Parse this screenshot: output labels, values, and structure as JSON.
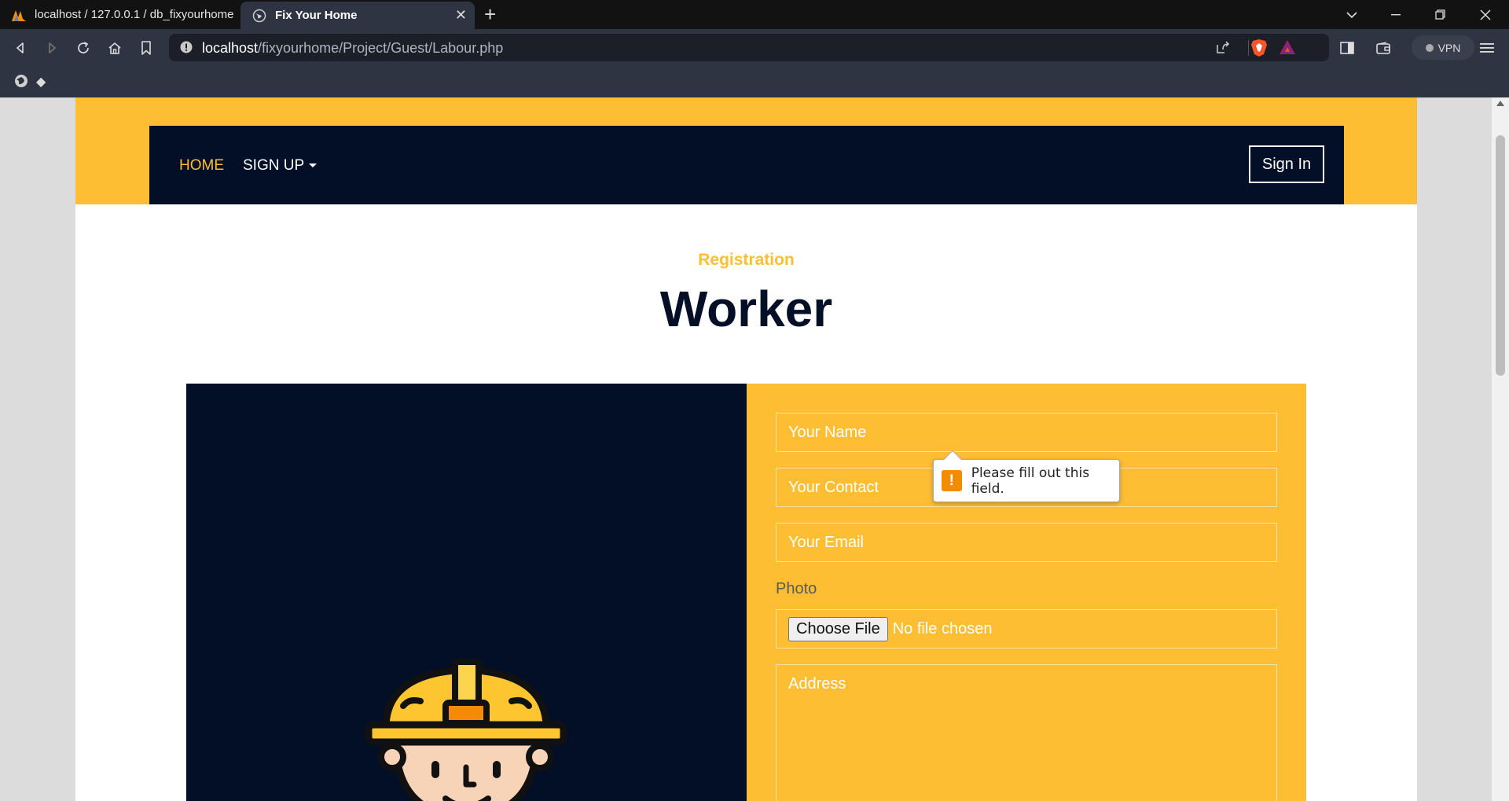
{
  "browser": {
    "tabs": [
      {
        "title": "localhost / 127.0.0.1 / db_fixyourhome",
        "active": false
      },
      {
        "title": "Fix Your Home",
        "active": true
      }
    ],
    "url_host": "localhost",
    "url_path": "/fixyourhome/Project/Guest/Labour.php",
    "vpn_label": "VPN",
    "bookmark_glyph": "◆"
  },
  "nav": {
    "home_label": "HOME",
    "signup_label": "SIGN UP",
    "signin_label": "Sign In"
  },
  "header": {
    "subtitle": "Registration",
    "title": "Worker"
  },
  "form": {
    "name_placeholder": "Your Name",
    "contact_placeholder": "Your Contact",
    "email_placeholder": "Your Email",
    "photo_label": "Photo",
    "file_button": "Choose File",
    "file_status": "No file chosen",
    "address_placeholder": "Address"
  },
  "validation": {
    "message": "Please fill out this field.",
    "icon": "!"
  },
  "colors": {
    "accent": "#fdbe33",
    "navy": "#030f27",
    "warning": "#f28c00"
  }
}
